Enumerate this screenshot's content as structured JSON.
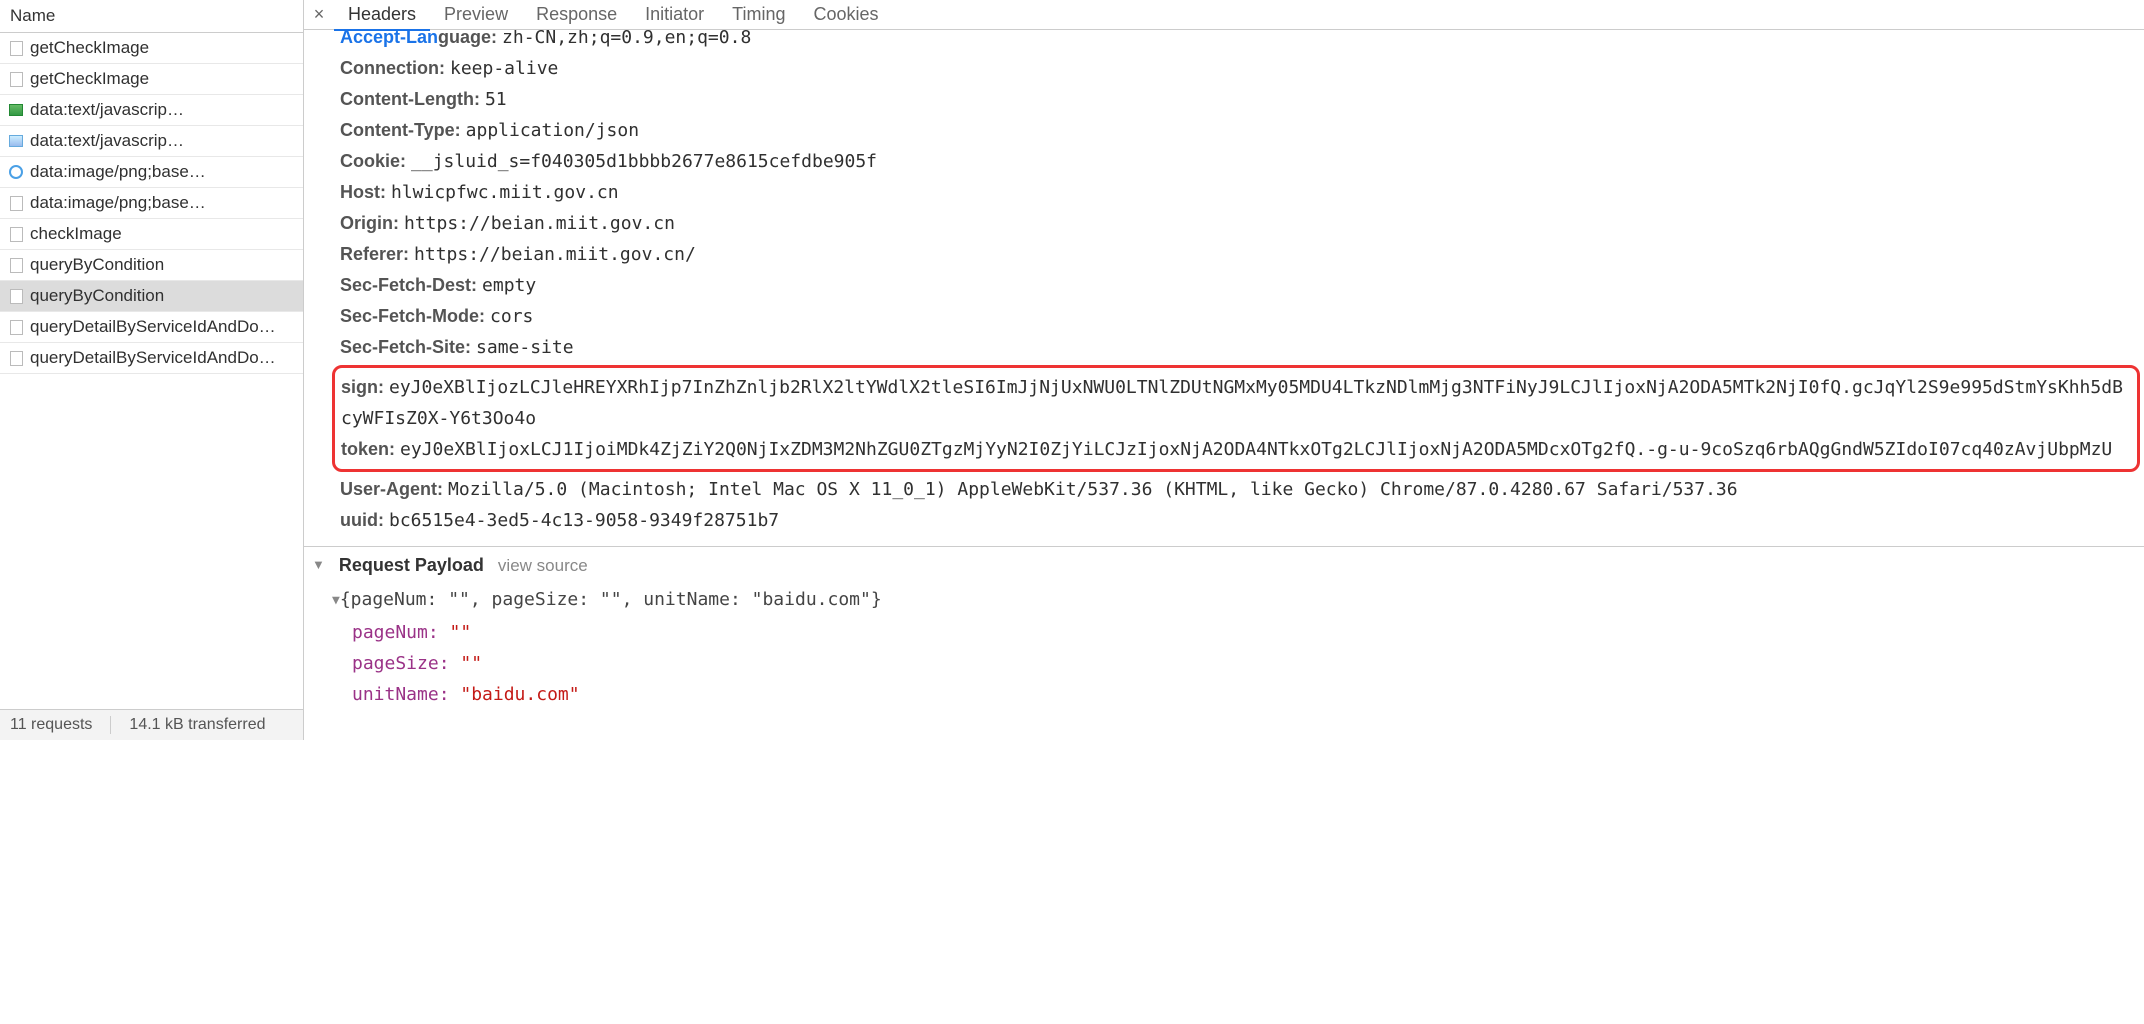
{
  "sidebar": {
    "title": "Name",
    "requests": [
      {
        "label": "getCheckImage",
        "icon": "doc"
      },
      {
        "label": "getCheckImage",
        "icon": "doc"
      },
      {
        "label": "data:text/javascrip…",
        "icon": "js"
      },
      {
        "label": "data:text/javascrip…",
        "icon": "png"
      },
      {
        "label": "data:image/png;base…",
        "icon": "png2"
      },
      {
        "label": "data:image/png;base…",
        "icon": "doc"
      },
      {
        "label": "checkImage",
        "icon": "doc"
      },
      {
        "label": "queryByCondition",
        "icon": "doc"
      },
      {
        "label": "queryByCondition",
        "icon": "doc",
        "selected": true
      },
      {
        "label": "queryDetailByServiceIdAndDo…",
        "icon": "doc"
      },
      {
        "label": "queryDetailByServiceIdAndDo…",
        "icon": "doc"
      }
    ],
    "footer": {
      "requests": "11 requests",
      "transferred": "14.1 kB transferred"
    }
  },
  "tabs": [
    "Headers",
    "Preview",
    "Response",
    "Initiator",
    "Timing",
    "Cookies"
  ],
  "activeTab": 0,
  "cutoff": "Accept-Language: zh-CN,zh;q=0.9,en;q=0.8",
  "headersBefore": [
    {
      "k": "Connection:",
      "v": "keep-alive"
    },
    {
      "k": "Content-Length:",
      "v": "51"
    },
    {
      "k": "Content-Type:",
      "v": "application/json"
    },
    {
      "k": "Cookie:",
      "v": "__jsluid_s=f040305d1bbbb2677e8615cefdbe905f"
    },
    {
      "k": "Host:",
      "v": "hlwicpfwc.miit.gov.cn"
    },
    {
      "k": "Origin:",
      "v": "https://beian.miit.gov.cn"
    },
    {
      "k": "Referer:",
      "v": "https://beian.miit.gov.cn/"
    },
    {
      "k": "Sec-Fetch-Dest:",
      "v": "empty"
    },
    {
      "k": "Sec-Fetch-Mode:",
      "v": "cors"
    },
    {
      "k": "Sec-Fetch-Site:",
      "v": "same-site"
    }
  ],
  "highlight": [
    {
      "k": "sign:",
      "v": "eyJ0eXBlIjozLCJleHREYXRhIjp7InZhZnljb2RlX2ltYWdlX2tleSI6ImJjNjUxNWU0LTNlZDUtNGMxMy05MDU4LTkzNDlmMjg3NTFiNyJ9LCJlIjoxNjA2ODA5MTk2NjI0fQ.gcJqYl2S9e995dStmYsKhh5dBcyWFIsZ0X-Y6t3Oo4o"
    },
    {
      "k": "token:",
      "v": "eyJ0eXBlIjoxLCJ1IjoiMDk4ZjZiY2Q0NjIxZDM3M2NhZGU0ZTgzMjYyN2I0ZjYiLCJzIjoxNjA2ODA4NTkxOTg2LCJlIjoxNjA2ODA5MDcxOTg2fQ.-g-u-9coSzq6rbAQgGndW5ZIdoI07cq40zAvjUbpMzU"
    }
  ],
  "headersAfter": [
    {
      "k": "User-Agent:",
      "v": "Mozilla/5.0 (Macintosh; Intel Mac OS X 11_0_1) AppleWebKit/537.36 (KHTML, like Gecko) Chrome/87.0.4280.67 Safari/537.36"
    },
    {
      "k": "uuid:",
      "v": "bc6515e4-3ed5-4c13-9058-9349f28751b7"
    }
  ],
  "payload": {
    "title": "Request Payload",
    "viewSource": "view source",
    "summary": "{pageNum: \"\", pageSize: \"\", unitName: \"baidu.com\"}",
    "props": [
      {
        "k": "pageNum:",
        "v": "\"\""
      },
      {
        "k": "pageSize:",
        "v": "\"\""
      },
      {
        "k": "unitName:",
        "v": "\"baidu.com\""
      }
    ]
  }
}
